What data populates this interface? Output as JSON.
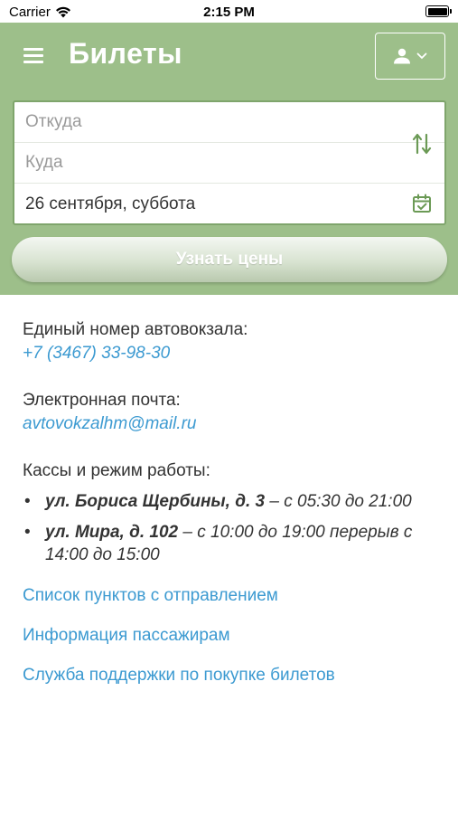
{
  "status_bar": {
    "carrier": "Carrier",
    "time": "2:15 PM"
  },
  "header": {
    "title": "Билеты"
  },
  "search": {
    "from_placeholder": "Откуда",
    "to_placeholder": "Куда",
    "date_value": "26 сентября, суббота",
    "submit_label": "Узнать цены"
  },
  "info": {
    "phone_label": "Единый номер автовокзала:",
    "phone": "+7 (3467) 33-98-30",
    "email_label": "Электронная почта:",
    "email": "avtovokzalhm@mail.ru",
    "cashiers_label": "Кассы и режим работы:",
    "cashiers": [
      {
        "address": "ул. Бориса Щербины, д. 3",
        "hours": " – с 05:30 до 21:00"
      },
      {
        "address": "ул. Мира, д. 102",
        "hours": " – с 10:00 до 19:00 перерыв с 14:00 до 15:00"
      }
    ]
  },
  "links": [
    "Список пунктов с отправлением",
    "Информация пассажирам",
    "Служба поддержки по покупке билетов"
  ],
  "colors": {
    "header_bg": "#9dbf8a",
    "accent": "#6b9a55",
    "link": "#3c9ad1"
  },
  "icons": [
    "wifi-icon",
    "battery-icon",
    "menu-icon",
    "user-icon",
    "chevron-down-icon",
    "swap-icon",
    "calendar-icon"
  ]
}
